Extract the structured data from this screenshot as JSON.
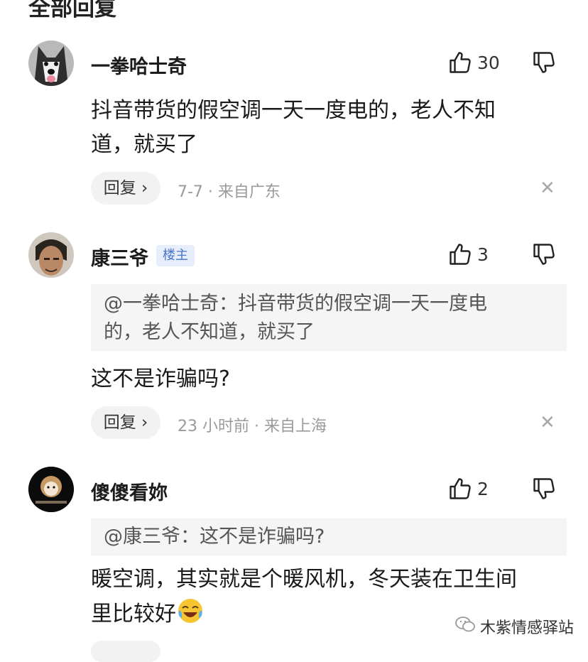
{
  "header": {
    "title": "全部回复"
  },
  "comments": [
    {
      "username": "一拳哈士奇",
      "likes": "30",
      "text_line1": "抖音带货的假空调一天一度电的，老人不知",
      "text_line2": "道，就买了",
      "reply_label": "回复 ›",
      "meta": "7-7 · 来自广东"
    },
    {
      "username": "康三爷",
      "badge": "楼主",
      "likes": "3",
      "quote_line1": "@一拳哈士奇：抖音带货的假空调一天一度电",
      "quote_line2": "的，老人不知道，就买了",
      "text_line1": "这不是诈骗吗?",
      "reply_label": "回复 ›",
      "meta": "23 小时前 · 来自上海"
    },
    {
      "username": "傻傻看妳",
      "likes": "2",
      "quote_line1": "@康三爷：这不是诈骗吗?",
      "text_line1": "暖空调，其实就是个暖风机，冬天装在卫生间",
      "text_line2": "里比较好",
      "emoji": "laughing-tears"
    }
  ],
  "close_symbol": "✕",
  "watermark": {
    "text": "木紫情感驿站"
  },
  "colors": {
    "badge_bg": "#e6eefb",
    "badge_text": "#4a74c9",
    "meta": "#9a9a9a"
  }
}
